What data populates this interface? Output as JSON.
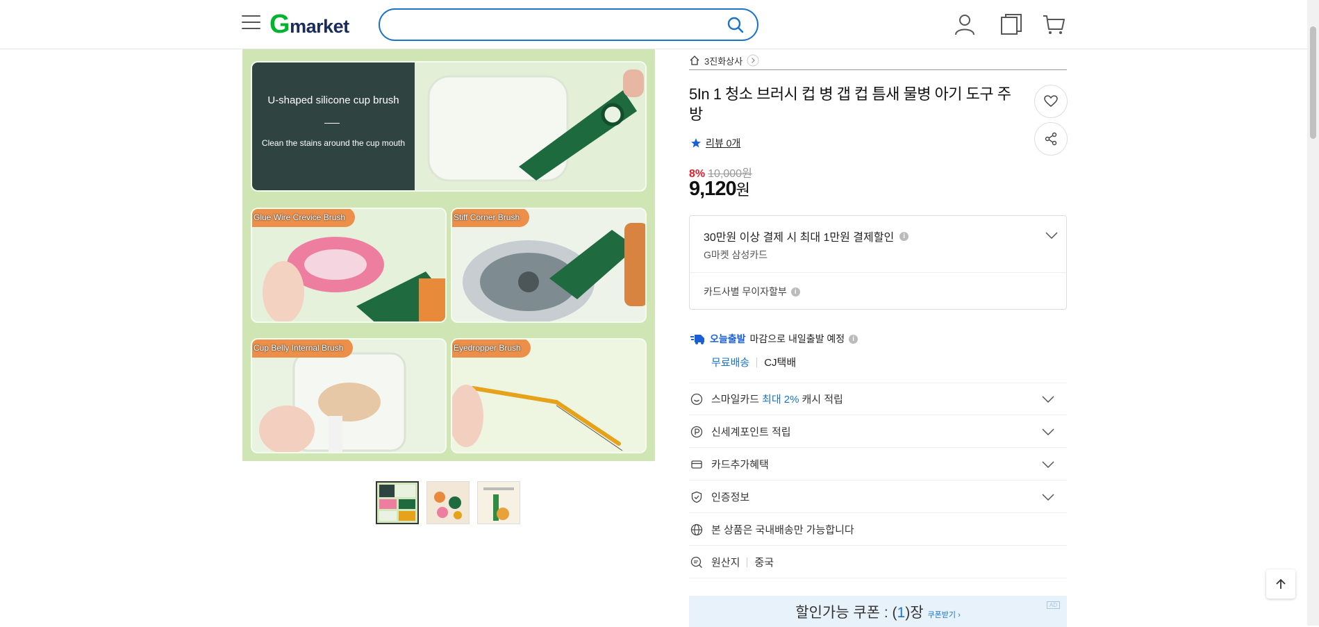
{
  "header": {
    "logo_g": "G",
    "logo_rest": "market",
    "search_placeholder": ""
  },
  "gallery": {
    "top_panel": {
      "heading": "U-shaped silicone cup brush",
      "subtext": "Clean the stains around the cup mouth"
    },
    "tags": [
      "Glue Wire Crevice Brush",
      "Stiff Corner Brush",
      "Cup Belly Internal Brush",
      "Eyedropper Brush"
    ]
  },
  "seller": {
    "name": "3진화상사"
  },
  "product": {
    "title": "5In 1 청소 브러시 컵 병 갭 컵 틈새 물병 아기 도구 주방",
    "review": "리뷰 0개",
    "discount_pct": "8%",
    "original_price": "10,000원",
    "price_value": "9,120",
    "price_unit": "원"
  },
  "card_benefit": {
    "headline": "30만원 이상 결제 시 최대 1만원 결제할인",
    "card_name": "G마켓 삼성카드",
    "installment": "카드사별 무이자할부"
  },
  "shipping": {
    "badge": "오늘출발",
    "text": "마감으로 내일출발 예정",
    "free": "무료배송",
    "carrier": "CJ택배"
  },
  "rows": {
    "smilecard_a": "스마일카드",
    "smilecard_b": "최대 2%",
    "smilecard_c": "캐시 적립",
    "ssg_point": "신세계포인트 적립",
    "card_extra": "카드추가혜택",
    "cert": "인증정보",
    "domestic": "본 상품은 국내배송만 가능합니다",
    "origin_label": "원산지",
    "origin_value": "중국"
  },
  "coupon": {
    "prefix": "할인가능 쿠폰 : (",
    "count": "1",
    "suffix": ")장",
    "get": "쿠폰받기 ›",
    "ad": "AD"
  },
  "colors": {
    "brand_green": "#00b42f",
    "brand_blue": "#1a73c9",
    "discount_red": "#e0202a"
  }
}
